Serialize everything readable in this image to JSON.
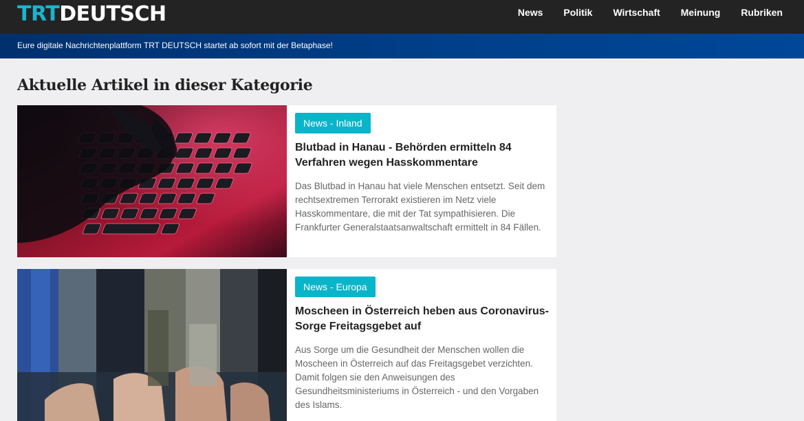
{
  "header": {
    "logo": {
      "part1": "TRT",
      "part2": "DEUTSCH"
    },
    "nav": [
      {
        "label": "News"
      },
      {
        "label": "Politik"
      },
      {
        "label": "Wirtschaft"
      },
      {
        "label": "Meinung"
      },
      {
        "label": "Rubriken"
      }
    ]
  },
  "banner": {
    "text": "Eure digitale Nachrichtenplattform TRT DEUTSCH startet ab sofort mit der Betaphase!"
  },
  "main": {
    "heading": "Aktuelle Artikel in dieser Kategorie",
    "articles": [
      {
        "tag": "News - Inland",
        "title": "Blutbad in Hanau - Behörden ermitteln 84 Verfahren wegen Hasskommentare",
        "summary": "Das Blutbad in Hanau hat viele Menschen entsetzt. Seit dem rechtsextremen Terrorakt existieren im Netz viele Hasskommentare, die mit der Tat sympathisieren. Die Frankfurter Generalstaatsanwaltschaft ermittelt in 84 Fällen.",
        "image": "keyboard-photo"
      },
      {
        "tag": "News - Europa",
        "title": "Moscheen in Österreich heben aus Coronavirus-Sorge Freitagsgebet auf",
        "summary": "Aus Sorge um die Gesundheit der Menschen wollen die Moscheen in Österreich auf das Freitagsgebet verzichten. Damit folgen sie den Anweisungen des Gesundheitsministeriums in Österreich - und den Vorgaben des Islams.",
        "image": "prayer-photo"
      }
    ]
  },
  "colors": {
    "topbar": "#232323",
    "brand_cyan": "#19b4cf",
    "banner_blue": "#003f8a",
    "tag_bg": "#0ab4c9",
    "page_bg": "#efeff1"
  }
}
